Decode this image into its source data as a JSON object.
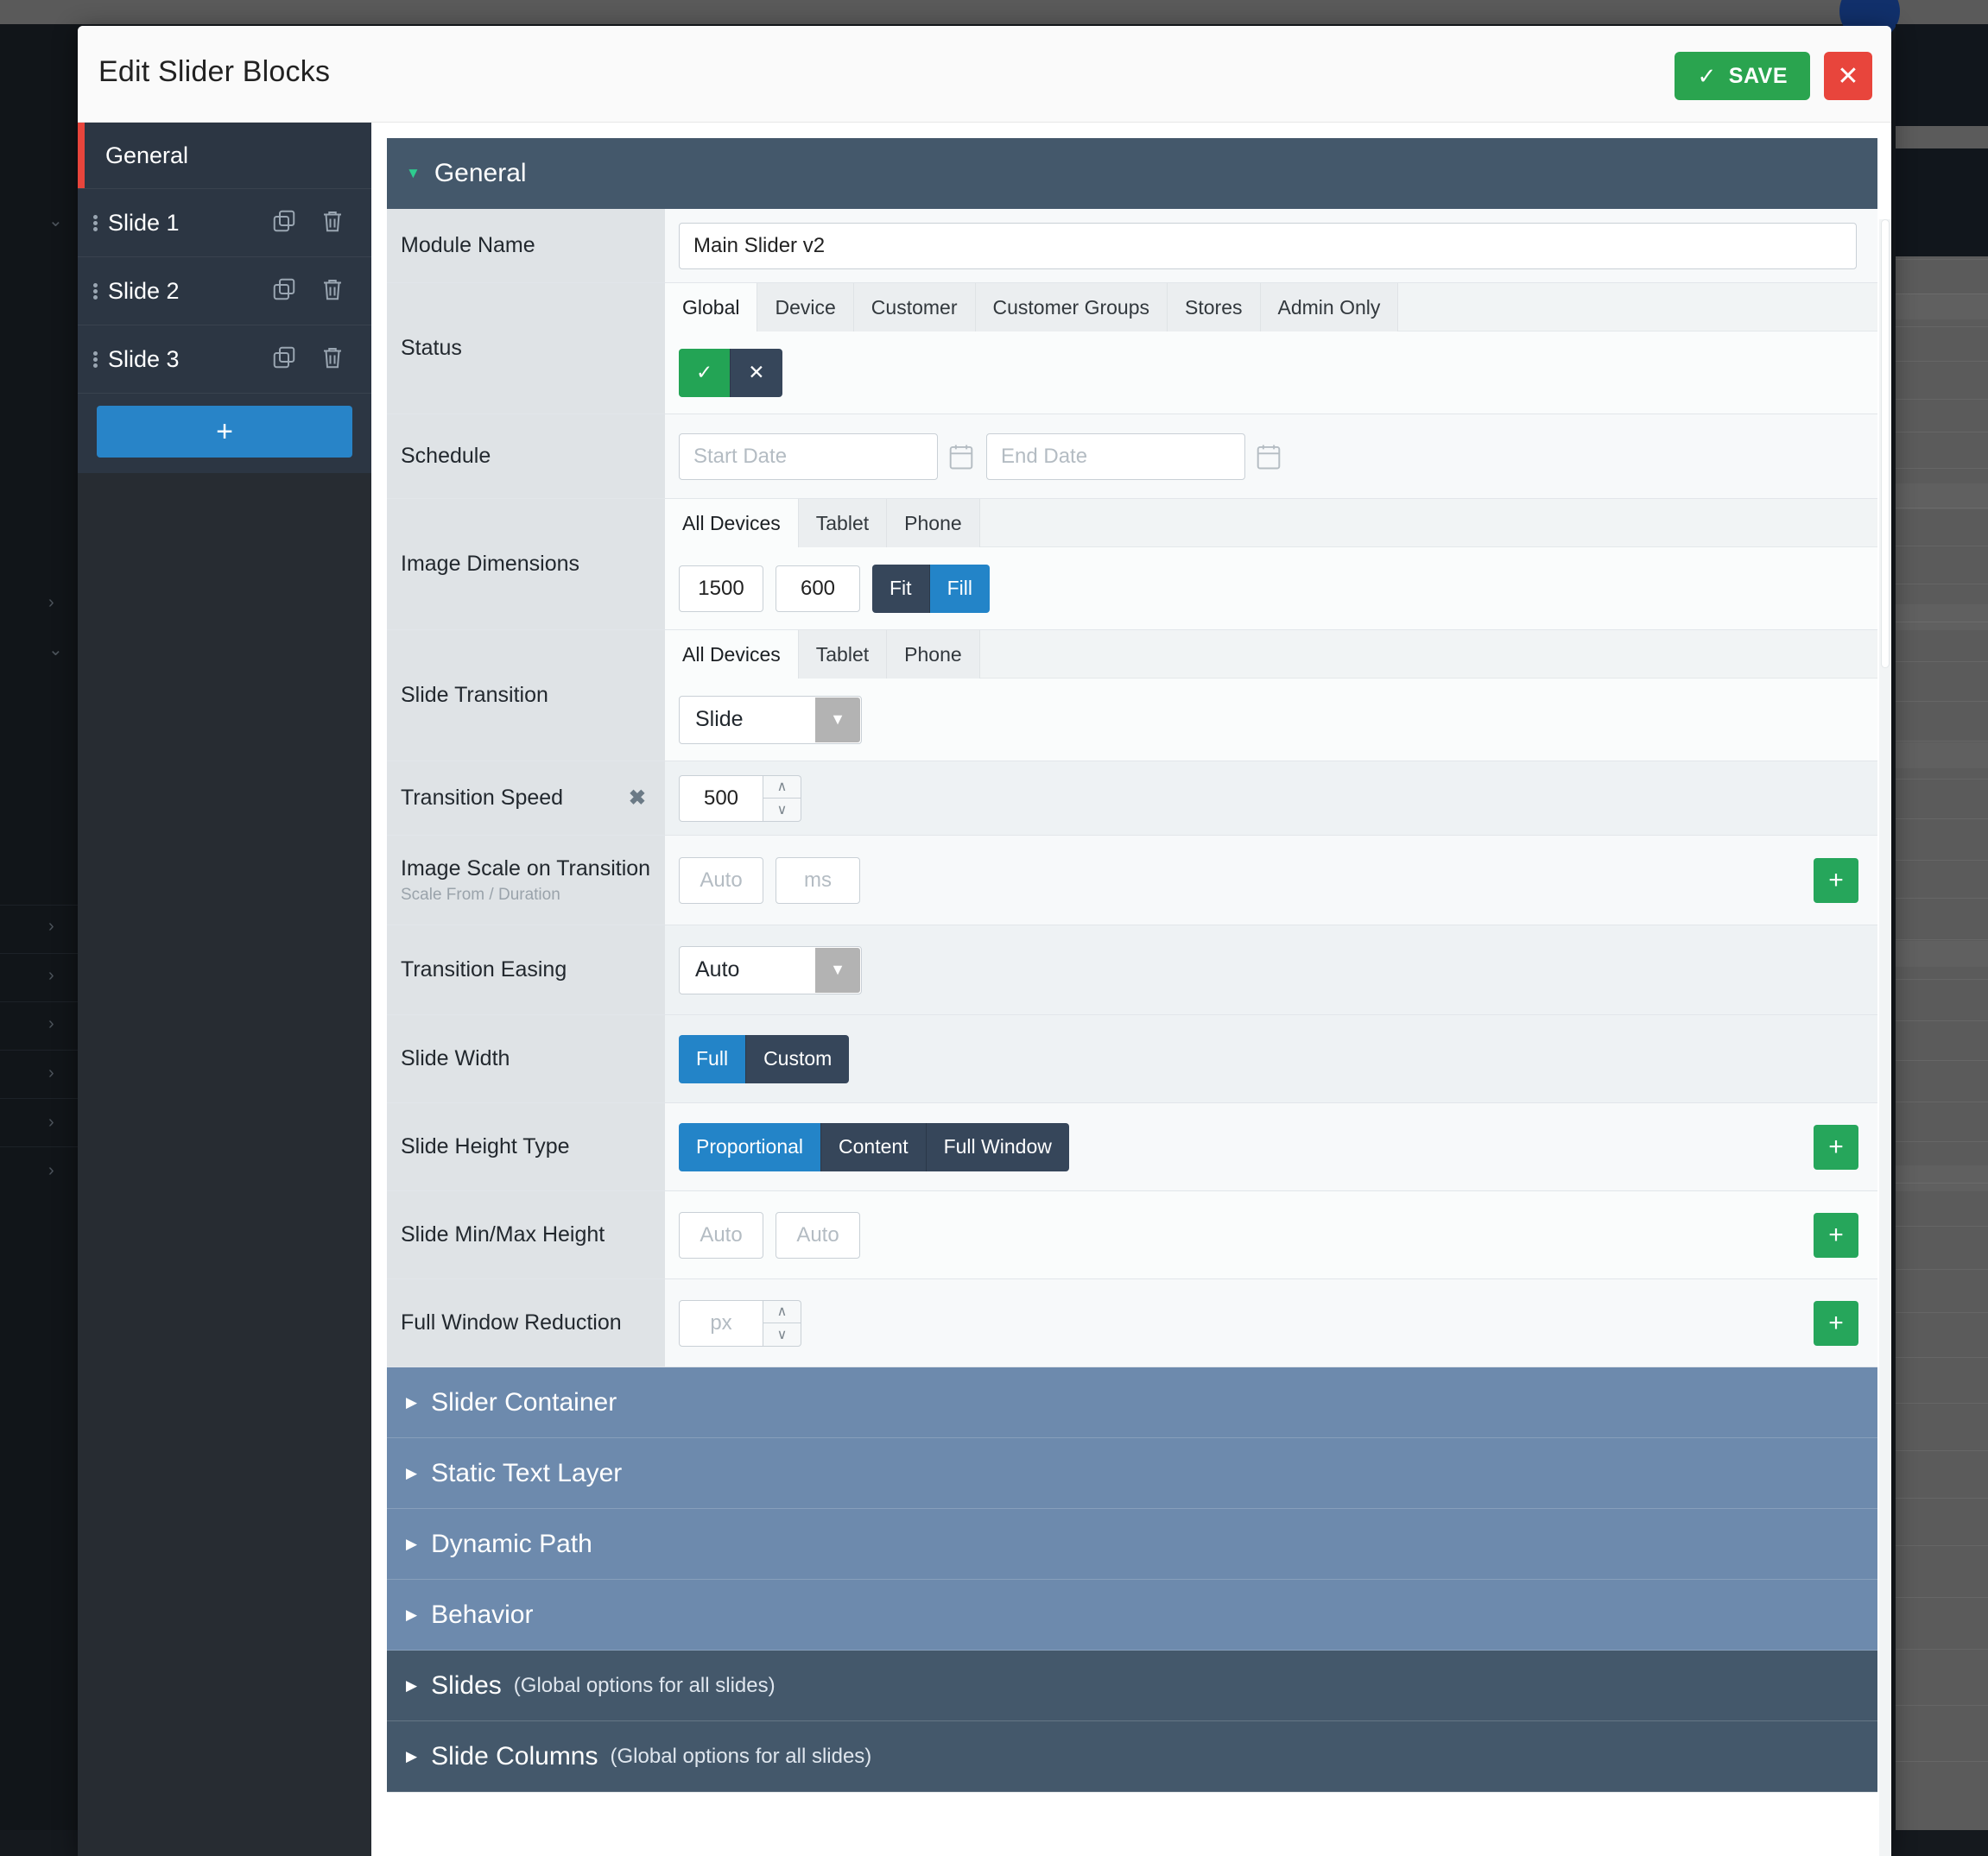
{
  "modal": {
    "title": "Edit Slider Blocks",
    "save_label": "SAVE",
    "save_icon": "check-icon",
    "close_icon": "close-x-icon"
  },
  "sidebar": {
    "general_label": "General",
    "slides": [
      {
        "label": "Slide 1",
        "duplicate_icon": "duplicate-icon",
        "delete_icon": "trash-icon",
        "grip_icon": "drag-handle-icon"
      },
      {
        "label": "Slide 2",
        "duplicate_icon": "duplicate-icon",
        "delete_icon": "trash-icon",
        "grip_icon": "drag-handle-icon"
      },
      {
        "label": "Slide 3",
        "duplicate_icon": "duplicate-icon",
        "delete_icon": "trash-icon",
        "grip_icon": "drag-handle-icon"
      }
    ],
    "add_slide_label": "+"
  },
  "section": {
    "general_header": "General",
    "caret_open": "▼"
  },
  "fields": {
    "module_name": {
      "label": "Module Name",
      "value": "Main Slider v2"
    },
    "status": {
      "label": "Status",
      "tabs": [
        "Global",
        "Device",
        "Customer",
        "Customer Groups",
        "Stores",
        "Admin Only"
      ],
      "active_tab": "Global",
      "enabled_icon": "✓",
      "disabled_icon": "✕",
      "selected": "enabled"
    },
    "schedule": {
      "label": "Schedule",
      "start_placeholder": "Start Date",
      "start_value": "",
      "end_placeholder": "End Date",
      "end_value": "",
      "calendar_icon": "calendar-icon"
    },
    "image_dimensions": {
      "label": "Image Dimensions",
      "tabs": [
        "All Devices",
        "Tablet",
        "Phone"
      ],
      "active_tab": "All Devices",
      "width": "1500",
      "height": "600",
      "modes": [
        "Fit",
        "Fill"
      ],
      "active_mode": "Fill"
    },
    "slide_transition": {
      "label": "Slide Transition",
      "tabs": [
        "All Devices",
        "Tablet",
        "Phone"
      ],
      "active_tab": "All Devices",
      "value": "Slide",
      "chevron_icon": "chevron-down-icon"
    },
    "transition_speed": {
      "label": "Transition Speed",
      "clear_icon": "✖",
      "value": "500",
      "up_icon": "∧",
      "down_icon": "∨"
    },
    "image_scale": {
      "label": "Image Scale on Transition",
      "sub_label": "Scale From / Duration",
      "scale_placeholder": "Auto",
      "scale_value": "",
      "duration_placeholder": "ms",
      "duration_value": "",
      "add_icon": "+"
    },
    "transition_easing": {
      "label": "Transition Easing",
      "value": "Auto",
      "chevron_icon": "chevron-down-icon"
    },
    "slide_width": {
      "label": "Slide Width",
      "options": [
        "Full",
        "Custom"
      ],
      "active": "Full"
    },
    "slide_height_type": {
      "label": "Slide Height Type",
      "options": [
        "Proportional",
        "Content",
        "Full Window"
      ],
      "active": "Proportional",
      "add_icon": "+"
    },
    "slide_minmax_height": {
      "label": "Slide Min/Max Height",
      "min_placeholder": "Auto",
      "min_value": "",
      "max_placeholder": "Auto",
      "max_value": "",
      "add_icon": "+"
    },
    "full_window_reduction": {
      "label": "Full Window Reduction",
      "placeholder": "px",
      "value": "",
      "up_icon": "∧",
      "down_icon": "∨",
      "add_icon": "+"
    }
  },
  "collapsed_sections": [
    {
      "label": "Slider Container",
      "note": "",
      "style": "blue",
      "caret": "▶"
    },
    {
      "label": "Static Text Layer",
      "note": "",
      "style": "blue",
      "caret": "▶"
    },
    {
      "label": "Dynamic Path",
      "note": "",
      "style": "blue",
      "caret": "▶"
    },
    {
      "label": "Behavior",
      "note": "",
      "style": "blue",
      "caret": "▶"
    },
    {
      "label": "Slides",
      "note": "(Global options for all slides)",
      "style": "dark",
      "caret": "▶"
    },
    {
      "label": "Slide Columns",
      "note": "(Global options for all slides)",
      "style": "dark",
      "caret": "▶"
    }
  ]
}
